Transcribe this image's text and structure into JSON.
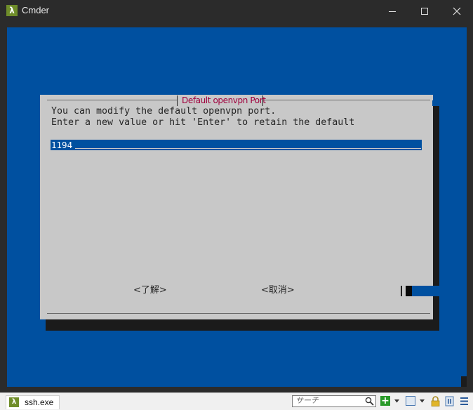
{
  "window": {
    "title": "Cmder",
    "app_icon": "λ",
    "controls": [
      "minimize-icon",
      "maximize-icon",
      "close-icon"
    ]
  },
  "dialog": {
    "title": "Default openvpn Port",
    "prompt_line1": "You can modify the default openvpn port.",
    "prompt_line2": "Enter a new value or hit 'Enter' to retain the default",
    "input_value": "1194",
    "ok_label": "<了解>",
    "cancel_label": "<取消>"
  },
  "statusbar": {
    "tab_label": "ssh.exe",
    "tab_icon": "λ",
    "search_placeholder": "サーチ",
    "add_symbol": "+",
    "icons": [
      "search-icon",
      "add-console-icon",
      "split-icon",
      "lock-icon",
      "pause-icon",
      "menu-icon"
    ]
  },
  "colors": {
    "console_bg": "#0050a0",
    "dialog_bg": "#c8c8c8",
    "dialog_title": "#a0003c",
    "titlebar_bg": "#2b2b2b",
    "app_icon_bg": "#6f8d2a"
  }
}
